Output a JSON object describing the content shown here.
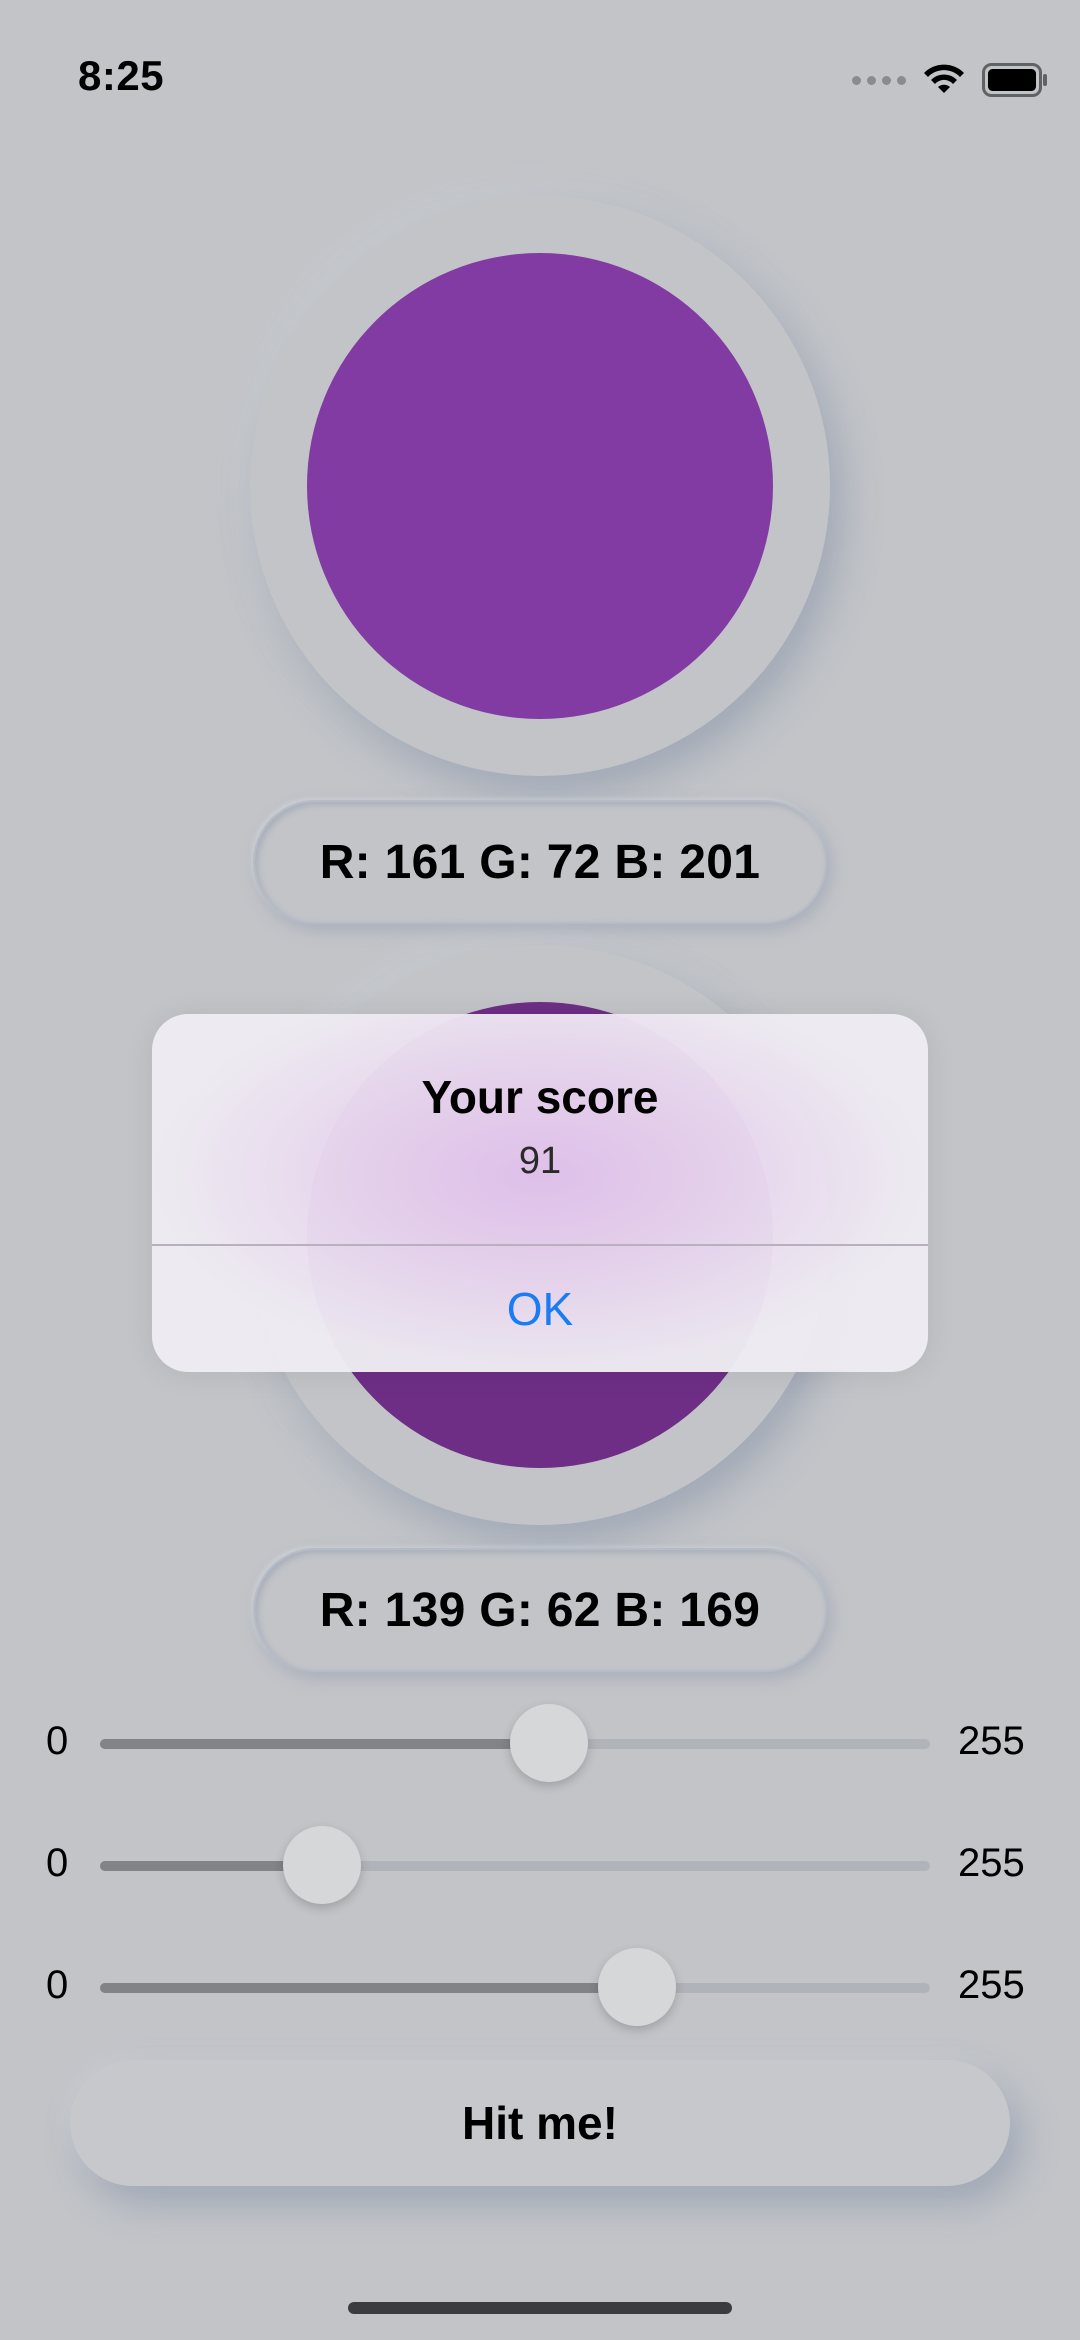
{
  "status_bar": {
    "time": "8:25"
  },
  "target": {
    "color": "#813ba2",
    "label": "R: 161  G: 72  B: 201"
  },
  "guess": {
    "color": "#6e2e86",
    "label": "R: 139  G: 62  B: 169"
  },
  "sliders": [
    {
      "min_label": "0",
      "max_label": "255",
      "value": 139,
      "max": 255
    },
    {
      "min_label": "0",
      "max_label": "255",
      "value": 62,
      "max": 255
    },
    {
      "min_label": "0",
      "max_label": "255",
      "value": 169,
      "max": 255
    }
  ],
  "hit_button": {
    "label": "Hit me!"
  },
  "alert": {
    "title": "Your score",
    "message": "91",
    "ok_label": "OK",
    "accent_color": "#1a7cf5"
  },
  "icons": [
    "cellular-dots-icon",
    "wifi-icon",
    "battery-icon"
  ]
}
